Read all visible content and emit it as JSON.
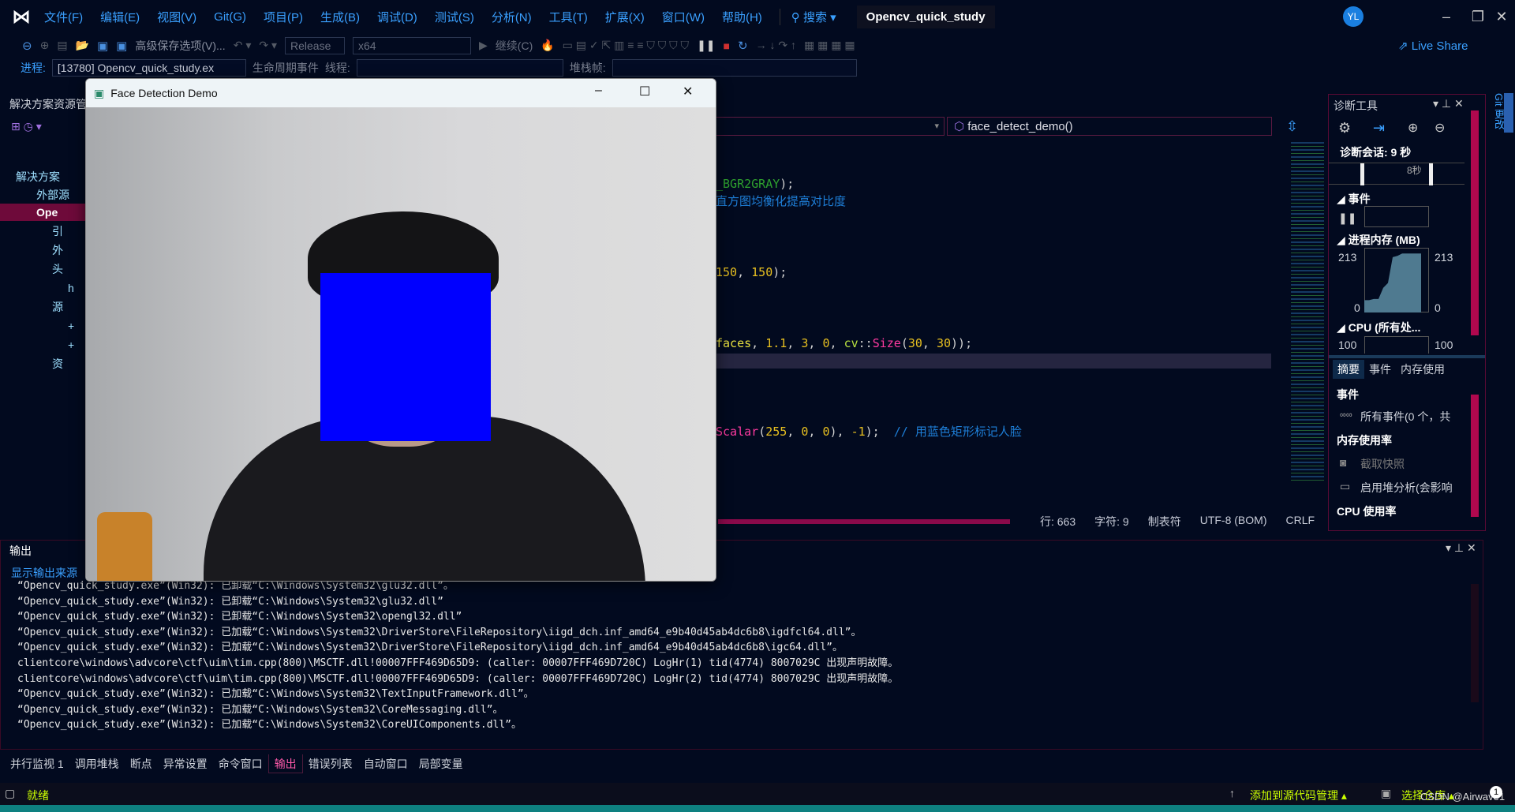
{
  "menubar": {
    "items": [
      "文件(F)",
      "编辑(E)",
      "视图(V)",
      "Git(G)",
      "项目(P)",
      "生成(B)",
      "调试(D)",
      "测试(S)",
      "分析(N)",
      "工具(T)",
      "扩展(X)",
      "窗口(W)",
      "帮助(H)"
    ],
    "search": "搜索",
    "solution_title": "Opencv_quick_study",
    "avatar": "YL"
  },
  "toolbar": {
    "advanced_save": "高级保存选项(V)...",
    "config": "Release",
    "platform": "x64",
    "continue": "继续(C)",
    "live_share": "Live Share"
  },
  "procbar": {
    "process_label": "进程:",
    "process_value": "[13780] Opencv_quick_study.ex",
    "lifecycle": "生命周期事件",
    "thread_label": "线程:",
    "stack_label": "堆栈帧:"
  },
  "solution_explorer": {
    "title": "解决方案资源管",
    "items": [
      {
        "label": "解决方案"
      },
      {
        "label": "外部源"
      },
      {
        "label": "Ope"
      },
      {
        "label": "引"
      },
      {
        "label": "外"
      },
      {
        "label": "头"
      },
      {
        "label": "h"
      },
      {
        "label": "源"
      },
      {
        "label": "+"
      },
      {
        "label": "+"
      },
      {
        "label": "资"
      }
    ]
  },
  "editor": {
    "function_dropdown": "face_detect_demo()",
    "lines": [
      [
        {
          "t": "_BGR2GRAY",
          "c": "#2ea02e"
        },
        {
          "t": ");",
          "c": "#d0d0d0"
        }
      ],
      [
        {
          "t": "直方图均衡化提高对比度",
          "c": "#1e7fd8"
        }
      ],
      [
        {
          "t": "150",
          "c": "#e8c020"
        },
        {
          "t": ", ",
          "c": "#d0d0d0"
        },
        {
          "t": "150",
          "c": "#e8c020"
        },
        {
          "t": ");",
          "c": "#d0d0d0"
        }
      ],
      [
        {
          "t": "faces",
          "c": "#e8e040"
        },
        {
          "t": ", ",
          "c": "#d0d0d0"
        },
        {
          "t": "1.1",
          "c": "#e8c020"
        },
        {
          "t": ", ",
          "c": "#d0d0d0"
        },
        {
          "t": "3",
          "c": "#e8c020"
        },
        {
          "t": ", ",
          "c": "#d0d0d0"
        },
        {
          "t": "0",
          "c": "#e8c020"
        },
        {
          "t": ", ",
          "c": "#d0d0d0"
        },
        {
          "t": "cv",
          "c": "#b8e040"
        },
        {
          "t": "::",
          "c": "#d0d0d0"
        },
        {
          "t": "Size",
          "c": "#ff3aa0"
        },
        {
          "t": "(",
          "c": "#d0d0d0"
        },
        {
          "t": "30",
          "c": "#e8c020"
        },
        {
          "t": ", ",
          "c": "#d0d0d0"
        },
        {
          "t": "30",
          "c": "#e8c020"
        },
        {
          "t": "));",
          "c": "#d0d0d0"
        }
      ],
      [
        {
          "t": "Scalar",
          "c": "#ff3aa0"
        },
        {
          "t": "(",
          "c": "#d0d0d0"
        },
        {
          "t": "255",
          "c": "#e8c020"
        },
        {
          "t": ", ",
          "c": "#d0d0d0"
        },
        {
          "t": "0",
          "c": "#e8c020"
        },
        {
          "t": ", ",
          "c": "#d0d0d0"
        },
        {
          "t": "0",
          "c": "#e8c020"
        },
        {
          "t": "), ",
          "c": "#d0d0d0"
        },
        {
          "t": "-1",
          "c": "#e8c020"
        },
        {
          "t": ");  ",
          "c": "#d0d0d0"
        },
        {
          "t": "// 用蓝色矩形标记人脸",
          "c": "#1e7fd8"
        }
      ]
    ],
    "status": {
      "line": "行: 663",
      "char": "字符: 9",
      "tabs": "制表符",
      "encoding": "UTF-8 (BOM)",
      "eol": "CRLF"
    }
  },
  "diagnostics": {
    "title": "诊断工具",
    "session": "诊断会话: 9 秒",
    "timeline_label": "8秒",
    "events": "事件",
    "memory": "进程内存 (MB)",
    "mem_max": "213",
    "mem_min": "0",
    "cpu": "CPU (所有处...",
    "cpu_max": "100",
    "tabs": [
      "摘要",
      "事件",
      "内存使用"
    ],
    "events_header": "事件",
    "all_events": "所有事件(0 个，共",
    "mem_usage": "内存使用率",
    "snapshot": "截取快照",
    "heap": "启用堆分析(会影响",
    "cpu_usage": "CPU 使用率",
    "memory_series": [
      20,
      20,
      22,
      22,
      40,
      48,
      90,
      92,
      96,
      96,
      96,
      96,
      96
    ]
  },
  "git_changes": "Git 更改",
  "output": {
    "title": "输出",
    "source_label": "显示输出来源",
    "lines": [
      "“Opencv_quick_study.exe”(Win32): 已卸载“C:\\Windows\\System32\\glu32.dll”。",
      "“Opencv_quick_study.exe”(Win32): 已卸载“C:\\Windows\\System32\\glu32.dll”",
      "“Opencv_quick_study.exe”(Win32): 已卸载“C:\\Windows\\System32\\opengl32.dll”",
      "“Opencv_quick_study.exe”(Win32): 已加载“C:\\Windows\\System32\\DriverStore\\FileRepository\\iigd_dch.inf_amd64_e9b40d45ab4dc6b8\\igdfcl64.dll”。",
      "“Opencv_quick_study.exe”(Win32): 已加载“C:\\Windows\\System32\\DriverStore\\FileRepository\\iigd_dch.inf_amd64_e9b40d45ab4dc6b8\\igc64.dll”。",
      "clientcore\\windows\\advcore\\ctf\\uim\\tim.cpp(800)\\MSCTF.dll!00007FFF469D65D9: (caller: 00007FFF469D720C) LogHr(1) tid(4774) 8007029C 出现声明故障。",
      "clientcore\\windows\\advcore\\ctf\\uim\\tim.cpp(800)\\MSCTF.dll!00007FFF469D65D9: (caller: 00007FFF469D720C) LogHr(2) tid(4774) 8007029C 出现声明故障。",
      "“Opencv_quick_study.exe”(Win32): 已加载“C:\\Windows\\System32\\TextInputFramework.dll”。",
      "“Opencv_quick_study.exe”(Win32): 已加载“C:\\Windows\\System32\\CoreMessaging.dll”。",
      "“Opencv_quick_study.exe”(Win32): 已加载“C:\\Windows\\System32\\CoreUIComponents.dll”。"
    ]
  },
  "bottom_tabs": [
    "并行监视 1",
    "调用堆栈",
    "断点",
    "异常设置",
    "命令窗口",
    "输出",
    "错误列表",
    "自动窗口",
    "局部变量"
  ],
  "statusbar": {
    "ready": "就绪",
    "add_source": "添加到源代码管理",
    "select_repo": "选择仓库",
    "notifications": "1",
    "watermark": "CSDN @Airwave1"
  },
  "face_window": {
    "title": "Face Detection Demo"
  },
  "colors": {
    "accent": "#3aa0ff",
    "ready": "#ccff00",
    "face_rect": "#0000ff"
  }
}
